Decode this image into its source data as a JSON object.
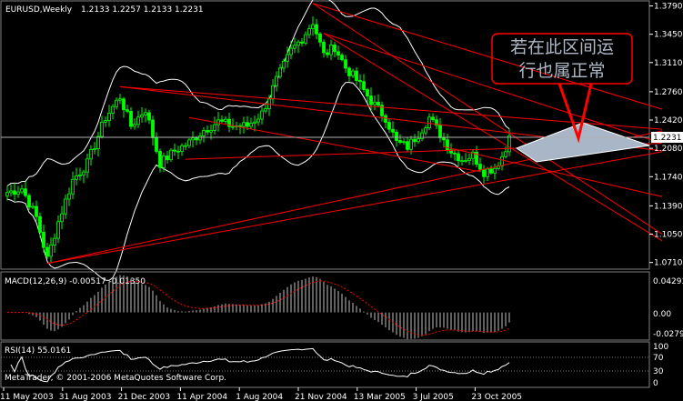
{
  "main_header": {
    "symbol": "EURUSD,Weekly",
    "ohlc": "1.2133 1.2257 1.2133 1.2231"
  },
  "macd_header": "MACD(12,26,9) -0.00517 -0.01350",
  "rsi_header": "RSI(14) 55.0161",
  "copyright": "MetaTrader, © 2001-2006 MetaQuotes Software Corp.",
  "annotation_text": [
    "若在此区间运",
    "行也属正常"
  ],
  "current_price_label": "1.2231",
  "colors": {
    "background": "#000000",
    "bull_candle": "#00ff00",
    "bear_candle": "#00ff00",
    "bollinger": "#ffffff",
    "trendline": "#ff0000",
    "grid": "#808080",
    "annotation": "#ff0000",
    "projection_zone": "#a9b6c8",
    "macd_histogram": "#c0c0c0",
    "macd_signal": "#ff0000"
  },
  "chart_data": {
    "type": "candlestick",
    "symbol": "EURUSD",
    "timeframe": "Weekly",
    "price_axis_ticks": [
      "1.3790",
      "1.3450",
      "1.3110",
      "1.2760",
      "1.2420",
      "1.2080",
      "1.1740",
      "1.1390",
      "1.1050",
      "1.0710"
    ],
    "price_range": [
      1.063,
      1.385
    ],
    "x_tick_labels": [
      "11 May 2003",
      "31 Aug 2003",
      "21 Dec 2003",
      "11 Apr 2004",
      "1 Aug 2004",
      "21 Nov 2004",
      "13 Mar 2005",
      "3 Jul 2005",
      "23 Oct 2005"
    ],
    "weeks": 139,
    "close_path": [
      [
        0,
        1.155
      ],
      [
        4,
        1.16
      ],
      [
        8,
        1.125
      ],
      [
        11,
        1.075
      ],
      [
        14,
        1.12
      ],
      [
        18,
        1.17
      ],
      [
        22,
        1.19
      ],
      [
        27,
        1.245
      ],
      [
        31,
        1.27
      ],
      [
        34,
        1.235
      ],
      [
        38,
        1.255
      ],
      [
        42,
        1.19
      ],
      [
        46,
        1.205
      ],
      [
        50,
        1.215
      ],
      [
        54,
        1.23
      ],
      [
        58,
        1.24
      ],
      [
        62,
        1.235
      ],
      [
        66,
        1.235
      ],
      [
        70,
        1.25
      ],
      [
        74,
        1.29
      ],
      [
        78,
        1.325
      ],
      [
        81,
        1.34
      ],
      [
        84,
        1.36
      ],
      [
        87,
        1.32
      ],
      [
        90,
        1.33
      ],
      [
        93,
        1.305
      ],
      [
        96,
        1.29
      ],
      [
        100,
        1.265
      ],
      [
        104,
        1.245
      ],
      [
        107,
        1.215
      ],
      [
        110,
        1.21
      ],
      [
        113,
        1.225
      ],
      [
        116,
        1.245
      ],
      [
        119,
        1.225
      ],
      [
        122,
        1.205
      ],
      [
        125,
        1.195
      ],
      [
        128,
        1.2
      ],
      [
        131,
        1.18
      ],
      [
        134,
        1.185
      ],
      [
        137,
        1.205
      ],
      [
        138,
        1.223
      ]
    ],
    "price_axis_labels": [
      "1.3790",
      "1.3450",
      "1.3110",
      "1.2760",
      "1.2420",
      "1.2080",
      "1.1740",
      "1.1390",
      "1.1050",
      "1.0710"
    ],
    "current_price": 1.2231,
    "macd": {
      "params": "12,26,9",
      "main": -0.00517,
      "signal": -0.0135,
      "axis_ticks": [
        "0.04293",
        "0.00",
        "-0.02791"
      ],
      "range": [
        -0.032,
        0.047
      ]
    },
    "rsi": {
      "period": 14,
      "value": 55.0161,
      "axis_ticks": [
        "100",
        "70",
        "30",
        "0"
      ],
      "range": [
        0,
        100
      ]
    }
  }
}
